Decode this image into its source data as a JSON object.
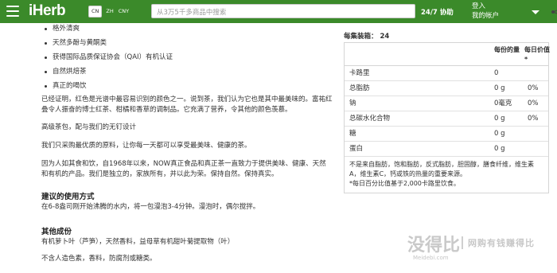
{
  "header": {
    "logo": "iHerb",
    "locale": {
      "country": "CN",
      "language": "ZH",
      "currency": "CNY"
    },
    "search_placeholder": "从3万5千多商品中搜索",
    "help": "24/7 协助",
    "login": "登入",
    "account": "我的帐户"
  },
  "description": {
    "bullets": [
      "格外清爽",
      "天然多酚与黄酮类",
      "获得国际品质保证协会（QAI）有机认证",
      "自然烘焙茶",
      "真正的喝饮"
    ],
    "paragraphs": [
      "已经证明，红色是光谱中最容易识别的颜色之一。说到茶，我们认为它也是其中最美味的。富祐红叠令人振奋的博士红茶、柑橘和香草的调制品。它充满了营养，令其他的颜色羡慕。",
      "高级茶包，配与我们的无钉设计",
      "我们只采购最优质的原料，让你每一天都可以享受最美味、健康的茶。",
      "因为人如其食和饮，自1968年以来，NOW真正食品和真正茶一直致力于提供美味、健康、天然和有机的产品。我们是独立的，家族所有，并以此为荣。保持自然。保持真实。"
    ]
  },
  "usage": {
    "heading": "建议的使用方式",
    "text": "在6-8盎司刚开始沸腾的水内，将一包漫泡3-4分钟。漫泡时，偶尔搅拌。"
  },
  "ingredients": {
    "heading": "其他成份",
    "text": "有机萝卜叶（芦笋），天然香料，益母草有机甜叶菊提取物（叶）",
    "note": "不含人造色素，香料，防腐剂或糖类。"
  },
  "nutrition": {
    "servings_label": "每集装箱：",
    "servings_value": "24",
    "col_amount": "每份的量",
    "col_daily": "每日价值*",
    "rows": [
      {
        "name": "卡路里",
        "amount": "0",
        "daily": ""
      },
      {
        "name": "总脂肪",
        "amount": "0 g",
        "daily": "0%"
      },
      {
        "name": "钠",
        "amount": "0毫克",
        "daily": "0%"
      },
      {
        "name": "总碳水化合物",
        "amount": "0 g",
        "daily": "0%"
      },
      {
        "name": "糖",
        "amount": "0 g",
        "daily": ""
      },
      {
        "name": "蛋白",
        "amount": "0 g",
        "daily": ""
      }
    ],
    "footnote_1": "不是来自脂肪，饱和脂肪，反式脂肪，胆固醇，膳食纤维，维生素A，维生素C，钙或铁的热量的重要来源。",
    "footnote_2": "*每日百分比值基于2,000卡路里饮食。"
  },
  "watermark": {
    "main": "没得比",
    "sub": "Meidebi.com",
    "right": "网购有钱赚得比"
  }
}
